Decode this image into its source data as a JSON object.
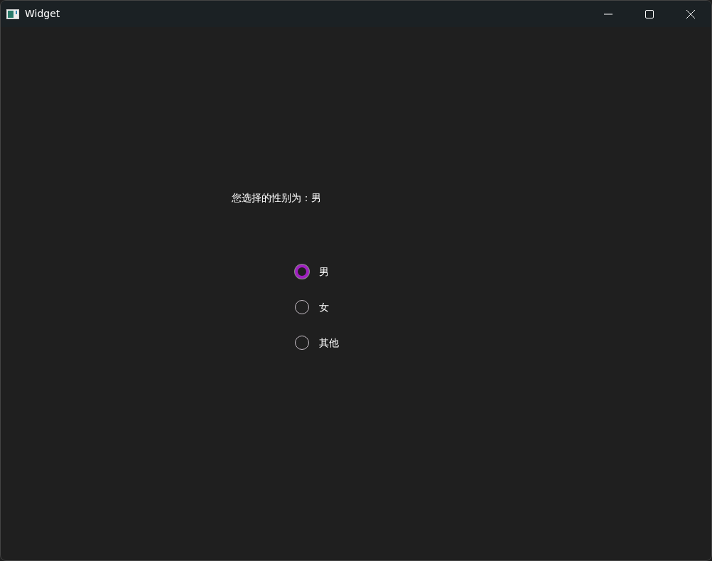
{
  "window": {
    "title": "Widget"
  },
  "result_label": "您选择的性别为：男",
  "options": [
    {
      "label": "男",
      "selected": true
    },
    {
      "label": "女",
      "selected": false
    },
    {
      "label": "其他",
      "selected": false
    }
  ]
}
